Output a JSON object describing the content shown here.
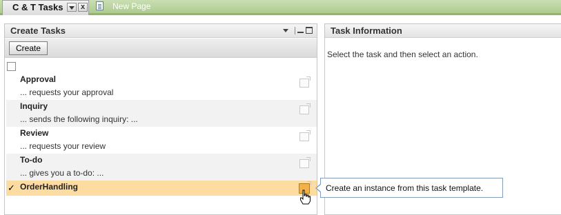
{
  "tabs": {
    "active_label": "C & T Tasks",
    "close_glyph": "x",
    "new_page_label": "New Page"
  },
  "create_tasks_panel": {
    "title": "Create Tasks",
    "create_button_label": "Create",
    "tasks": [
      {
        "name": "Approval",
        "description": "... requests your approval",
        "checked": false
      },
      {
        "name": "Inquiry",
        "description": "... sends the following inquiry: ...",
        "checked": false
      },
      {
        "name": "Review",
        "description": "... requests your review",
        "checked": false
      },
      {
        "name": "To-do",
        "description": "... gives you a to-do: ...",
        "checked": false
      },
      {
        "name": "OrderHandling",
        "description": "",
        "checked": true
      }
    ],
    "check_glyph": "✓"
  },
  "task_info_panel": {
    "title": "Task Information",
    "message": "Select the task and then select an action."
  },
  "tooltip": {
    "text": "Create an instance from this task template."
  },
  "colors": {
    "tab_strip": "#aecb8f",
    "selected_row": "#fddca1",
    "action_hover": "#f3b247",
    "tooltip_border": "#7f9db9"
  },
  "icons": [
    "page-icon",
    "dropdown-arrow-icon",
    "minimize-icon",
    "maximize-icon",
    "create-instance-icon",
    "hand-cursor-icon"
  ]
}
